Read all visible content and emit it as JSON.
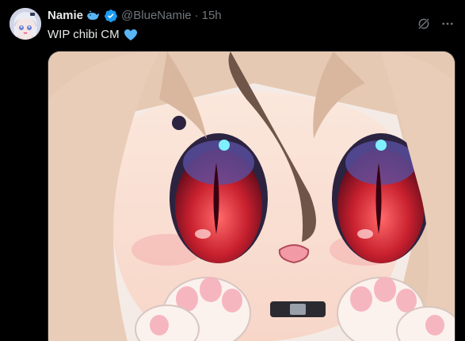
{
  "tweet": {
    "author": {
      "display_name": "Namie",
      "handle": "@BlueNamie",
      "separator": "·",
      "timestamp": "15h",
      "badges": [
        "whale-icon",
        "verified-badge-icon"
      ]
    },
    "text": "WIP chibi CM",
    "emoji": "blue-heart-icon",
    "actions": [
      "grok-icon",
      "more-icon"
    ],
    "media": {
      "type": "image",
      "subject": "chibi-artwork"
    }
  },
  "colors": {
    "background": "#000000",
    "text_primary": "#e7e9ea",
    "text_secondary": "#71767b",
    "verified": "#1d9bf0",
    "heart": "#5ab5f5",
    "divider": "#2f3336"
  }
}
